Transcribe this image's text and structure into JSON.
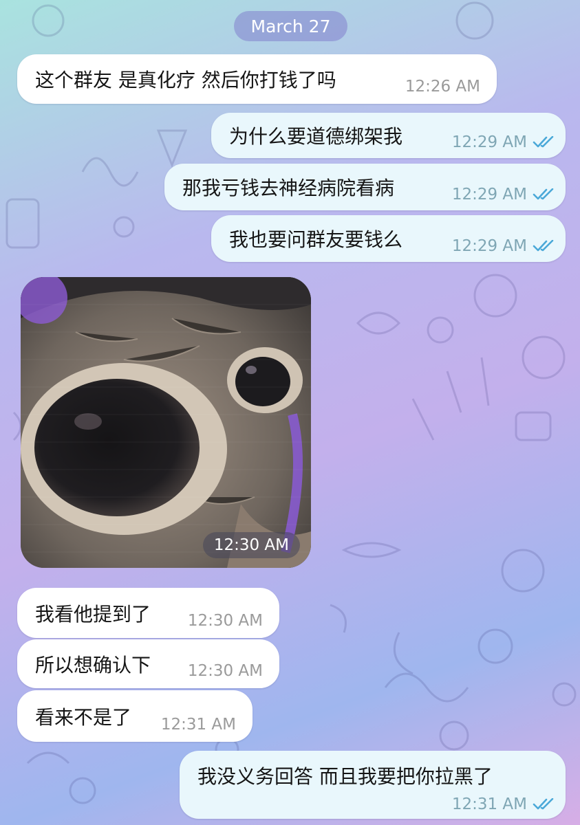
{
  "chat": {
    "date_label": "March 27",
    "messages": [
      {
        "direction": "incoming",
        "text": "这个群友 是真化疗 然后你打钱了吗",
        "time": "12:26 AM"
      },
      {
        "direction": "outgoing",
        "text": "为什么要道德绑架我",
        "time": "12:29 AM",
        "status": "read"
      },
      {
        "direction": "outgoing",
        "text": "那我亏钱去神经病院看病",
        "time": "12:29 AM",
        "status": "read"
      },
      {
        "direction": "outgoing",
        "text": "我也要问群友要钱么",
        "time": "12:29 AM",
        "status": "read"
      },
      {
        "direction": "incoming",
        "type": "image",
        "image": "cat-eye-closeup-sticker",
        "time": "12:30 AM"
      },
      {
        "direction": "incoming",
        "text": "我看他提到了",
        "time": "12:30 AM"
      },
      {
        "direction": "incoming",
        "text": "所以想确认下",
        "time": "12:30 AM"
      },
      {
        "direction": "incoming",
        "text": "看来不是了",
        "time": "12:31 AM"
      },
      {
        "direction": "outgoing",
        "text": "我没义务回答 而且我要把你拉黑了",
        "time": "12:31 AM",
        "status": "read"
      }
    ]
  },
  "icons": {
    "read_status": "double-check-icon"
  },
  "colors": {
    "incoming_bubble": "#ffffff",
    "outgoing_bubble": "#e9f7fc",
    "read_check": "#4aa8d8",
    "date_pill": "#8c80cf"
  }
}
